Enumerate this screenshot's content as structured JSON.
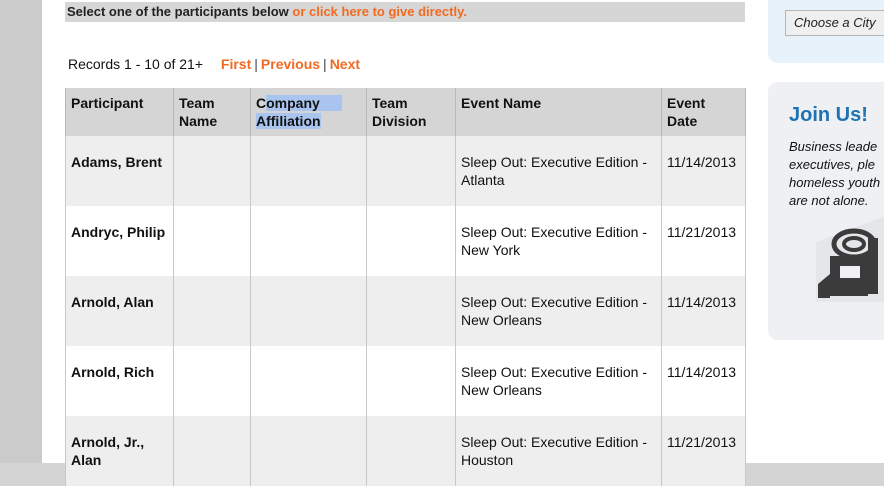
{
  "notice": {
    "text": "Select one of the participants below ",
    "link": "or click here to give directly."
  },
  "records": {
    "summary": "Records 1 - 10 of 21+",
    "first": "First",
    "previous": "Previous",
    "next": "Next",
    "separator": "|"
  },
  "table": {
    "headers": {
      "participant": "Participant",
      "team_name_1": "Team",
      "team_name_2": "Name",
      "company_1a": "C",
      "company_1b": "ompany",
      "company_2": "Affiliation",
      "team_division_1": "Team",
      "team_division_2": "Division",
      "event_name": "Event Name",
      "event_date_1": "Event",
      "event_date_2": "Date"
    },
    "rows": [
      {
        "name": "Adams, Brent",
        "name_2": "",
        "event_1": "Sleep Out: Executive Edition -",
        "event_2": "Atlanta",
        "date": "11/14/2013"
      },
      {
        "name": "Andryc, Philip",
        "name_2": "",
        "event_1": "Sleep Out: Executive Edition -",
        "event_2": "New York",
        "date": "11/21/2013"
      },
      {
        "name": "Arnold, Alan",
        "name_2": "",
        "event_1": "Sleep Out: Executive Edition -",
        "event_2": "New Orleans",
        "date": "11/14/2013"
      },
      {
        "name": "Arnold, Rich",
        "name_2": "",
        "event_1": "Sleep Out: Executive Edition -",
        "event_2": "New Orleans",
        "date": "11/14/2013"
      },
      {
        "name": "Arnold, Jr.,",
        "name_2": "Alan",
        "event_1": "Sleep Out: Executive Edition -",
        "event_2": "Houston",
        "date": "11/21/2013"
      }
    ]
  },
  "sidebar": {
    "city_select": "Choose a City",
    "join_title": "Join Us!",
    "join_lines": [
      "Business leade",
      "executives, ple",
      "homeless youth",
      "are not alone."
    ]
  },
  "colors": {
    "accent": "#f26a22",
    "join_title": "#1e73b4",
    "selection": "#a8c4ef"
  },
  "icons": {
    "sidebar_graphic": "sleep-out-sign-icon"
  }
}
